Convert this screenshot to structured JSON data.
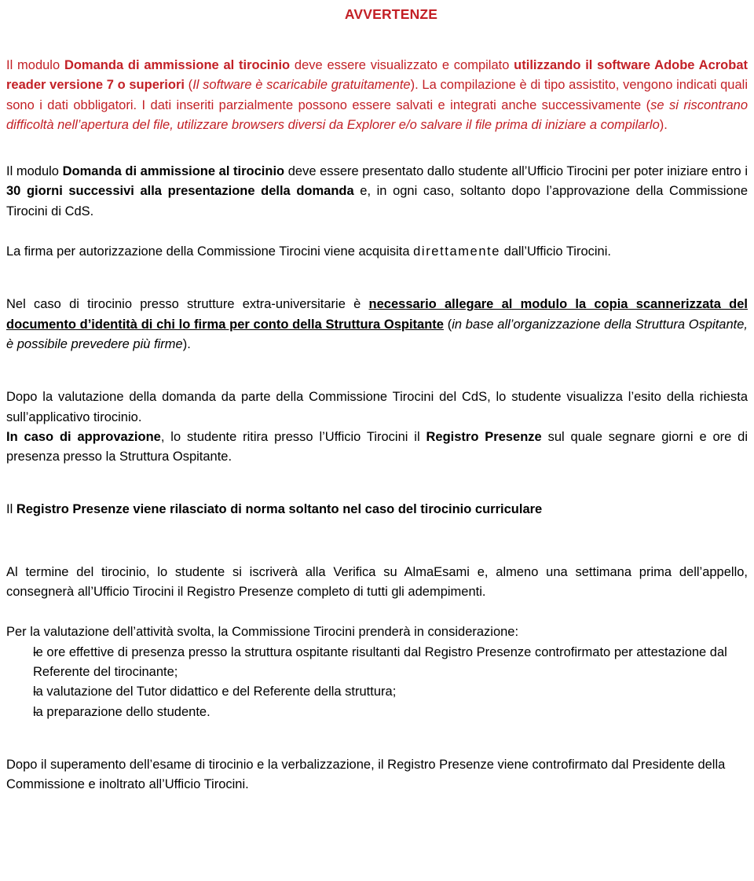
{
  "document": {
    "title": "AVVERTENZE",
    "title_color": "#c32026",
    "body_color": "#000000"
  },
  "sections": {
    "warning_red": {
      "p1_a": "Il modulo ",
      "p1_b": "Domanda di ammissione al tirocinio",
      "p1_c": " deve essere visualizzato e compilato ",
      "p1_d": "utilizzando il software Adobe Acrobat reader versione 7 o superiori",
      "p1_e": " (",
      "p1_f": "Il software è scaricabile gratuitamente",
      "p1_g": "). La compilazione è di tipo assistito, vengono indicati quali sono i dati obbligatori. I dati inseriti parzialmente possono essere salvati e integrati anche successivamente (",
      "p1_h": "se si riscontrano difficoltà nell’apertura del file, utilizzare browsers diversi da Explorer e/o salvare il file prima di iniziare a compilarlo",
      "p1_i": ")."
    },
    "submission": {
      "p2_a": "Il modulo ",
      "p2_b": "Domanda di ammissione al tirocinio",
      "p2_c": " deve essere presentato dallo studente all’Ufficio Tirocini per poter iniziare entro i ",
      "p2_d": "30 giorni successivi alla presentazione della domanda",
      "p2_e": " e, in ogni caso, soltanto dopo l’approvazione della Commissione Tirocini di CdS."
    },
    "signature": {
      "p3_a": "La firma per autorizzazione della Commissione Tirocini viene acquisita ",
      "p3_b": "direttamente",
      "p3_c": " dall’Ufficio Tirocini."
    },
    "extra_university": {
      "p4_a": "Nel caso di tirocinio presso strutture extra-universitarie  è ",
      "p4_b": "necessario allegare al modulo la copia scannerizzata del documento",
      "p4_c": " d’identità di chi lo firma per conto della Struttura Ospitante",
      "p4_d": " (",
      "p4_e": "in base all’organizzazione della Struttura Ospitante, è possibile prevedere più firme",
      "p4_f": ")."
    },
    "evaluation": {
      "p5": "Dopo la valutazione della domanda da parte della Commissione Tirocini del CdS, lo studente visualizza l’esito della richiesta sull’applicativo tirocinio.",
      "p6_a": "In caso di approvazione",
      "p6_b": ", lo studente ritira presso l’Ufficio Tirocini il ",
      "p6_c": "Registro Presenze",
      "p6_d": " sul quale segnare giorni e ore di presenza presso la Struttura Ospitante."
    },
    "registro_note": {
      "p7_a": "Il ",
      "p7_b": "Registro Presenze viene rilasciato di norma soltanto nel caso del tirocinio curriculare"
    },
    "end_of_internship": {
      "p8": "Al termine del tirocinio, lo studente si iscriverà alla Verifica su AlmaEsami e, almeno una settimana prima dell’appello, consegnerà all’Ufficio Tirocini il Registro Presenze completo di tutti gli adempimenti."
    },
    "criteria": {
      "intro": "Per la valutazione dell’attività svolta, la Commissione Tirocini prenderà in considerazione:",
      "dash": "-",
      "items": [
        "le ore effettive di presenza presso la struttura ospitante risultanti dal Registro Presenze controfirmato per attestazione dal Referente del tirocinante;",
        "la valutazione del Tutor didattico e del Referente della struttura;",
        "la preparazione dello studente."
      ]
    },
    "closing": {
      "p9": "Dopo il superamento dell’esame di tirocinio e la verbalizzazione, il Registro Presenze viene controfirmato dal Presidente della Commissione  e  inoltrato all’Ufficio Tirocini."
    }
  }
}
